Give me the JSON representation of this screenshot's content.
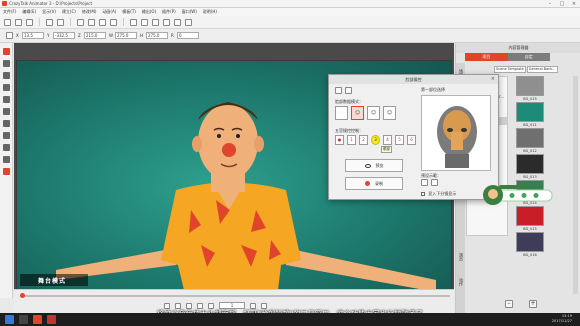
{
  "window": {
    "title": "CrazyTalk Animator 3 - D:\\Projects\\Project"
  },
  "menu": [
    "文件(F)",
    "编辑(E)",
    "显示(V)",
    "建立(C)",
    "修改(M)",
    "动画(A)",
    "模板(T)",
    "输出(O)",
    "插件(P)",
    "窗口(W)",
    "说明(H)"
  ],
  "transform": {
    "x_label": "X",
    "x_value": "13.5",
    "y_label": "Y",
    "y_value": "-332.5",
    "z_label": "Z",
    "z_value": "215.0",
    "sx_label": "W",
    "sx_value": "275.0",
    "sy_label": "H",
    "sy_value": "275.0",
    "r_label": "R",
    "r_value": "0"
  },
  "stage": {
    "mode_label": "舞台模式"
  },
  "timeline": {
    "frame": "1"
  },
  "content_manager": {
    "title": "内容管理器",
    "tabs": [
      "项目",
      "自定"
    ],
    "active_tab": 0,
    "side_tabs": [
      "场景",
      "演员",
      "动作"
    ],
    "path": [
      "Scene Template",
      "General Back..."
    ],
    "tree": [
      "Template",
      "",
      "General Backgr...",
      "",
      "ness and Pr...",
      "ness and Pr...",
      "Laser",
      "round"
    ],
    "tree_selected": 5,
    "thumbs": [
      {
        "label": "BG_015",
        "color": "#8f8f8f"
      },
      {
        "label": "BG_011",
        "color": "#1e8a78"
      },
      {
        "label": "BG_012",
        "color": "#6f6f6f"
      },
      {
        "label": "BG_013",
        "color": "#2b2b2b"
      },
      {
        "label": "BG_014",
        "color": "#3a7d52"
      },
      {
        "label": "BG_015",
        "color": "#c81e28"
      },
      {
        "label": "BG_016",
        "color": "#3d3d5a"
      }
    ]
  },
  "dialog": {
    "title": "脸部操控",
    "section_face": "脸部数据模式：",
    "section_control": "五官操控控制：",
    "section_preview": "第一部位选择",
    "preview_label": "预设示範：",
    "btn_preview": "预览",
    "btn_record": "录制",
    "checkbox_label": "显入下分镜显示",
    "face_buttons": [
      "",
      "☺",
      "☺",
      "☺"
    ],
    "control_buttons": [
      "●",
      "1",
      "2",
      "3",
      "4",
      "5",
      "6"
    ],
    "tooltip": "眼部"
  },
  "subtitle": "将这个角色放大头部面部，打开\"脸部操控\"的工具窗口，这个功能大家也比较熟悉了",
  "clock": {
    "time": "15:19",
    "date": "2017/11/27"
  },
  "colors": {
    "accent": "#e0452b",
    "stage_teal": "#1f7f72"
  }
}
